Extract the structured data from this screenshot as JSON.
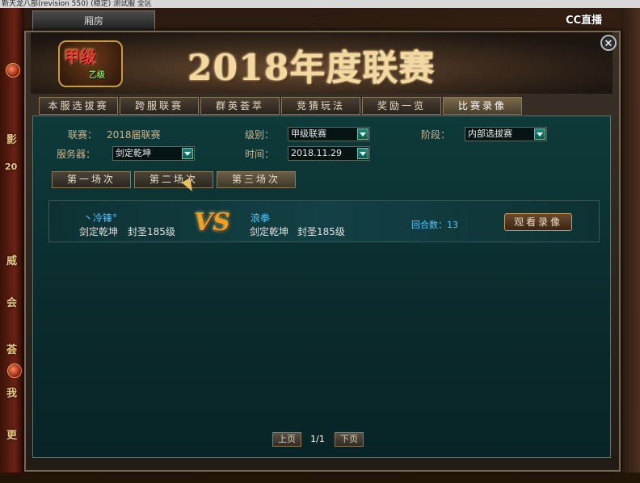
{
  "window_bar": {
    "title": "新天龙八部(revision 550) (稳定) 测试服 全区"
  },
  "mini_tab": {
    "label": "厢房"
  },
  "overlay": {
    "cc_label": "CC直播"
  },
  "banner": {
    "title": "2018年度联赛",
    "logo_main": "甲级",
    "logo_sub": "乙级"
  },
  "close": {
    "glyph": "✕"
  },
  "tabs": [
    {
      "label": "本服选拔赛"
    },
    {
      "label": "跨服联赛"
    },
    {
      "label": "群英荟萃"
    },
    {
      "label": "竞猜玩法"
    },
    {
      "label": "奖励一览"
    },
    {
      "label": "比赛录像"
    }
  ],
  "filters": {
    "league_label": "联赛：",
    "league_value": "2018届联赛",
    "level_label": "级别：",
    "level_value": "甲级联赛",
    "stage_label": "阶段：",
    "stage_value": "内部选拔赛",
    "server_label": "服务器：",
    "server_value": "剑定乾坤",
    "time_label": "时间：",
    "time_value": "2018.11.29"
  },
  "subtabs": [
    {
      "label": "第一场次"
    },
    {
      "label": "第二场次"
    },
    {
      "label": "第三场次"
    }
  ],
  "match": {
    "left_name": "丶冷锋°",
    "left_server": "剑定乾坤",
    "left_level": "封圣185级",
    "vs": "VS",
    "right_name": "浪拳",
    "right_server": "剑定乾坤",
    "right_level": "封圣185级",
    "rounds_label": "回合数：13",
    "watch_label": "观看录像"
  },
  "pager": {
    "prev": "上页",
    "page": "1/1",
    "next": "下页"
  },
  "side": {
    "left_glyphs": [
      "影",
      "20",
      "威",
      "会",
      "荟",
      "我",
      "更"
    ]
  }
}
